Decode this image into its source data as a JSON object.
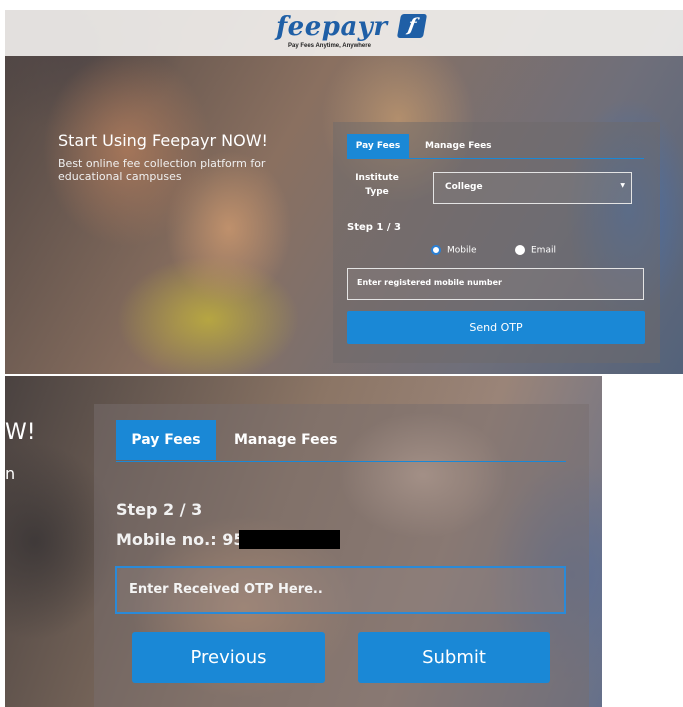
{
  "brand": {
    "logo_text": "feepayr",
    "logo_mark": "f",
    "tagline": "Pay Fees Anytime, Anywhere"
  },
  "hero": {
    "title": "Start Using Feepayr NOW!",
    "subtitle": "Best online fee collection platform for educational campuses"
  },
  "step1_form": {
    "tabs": [
      "Pay Fees",
      "Manage Fees"
    ],
    "active_tab": "Pay Fees",
    "institute_type_label": "Institute Type",
    "institute_type_value": "College",
    "step_label": "Step 1 / 3",
    "radio_options": [
      "Mobile",
      "Email"
    ],
    "selected_option": "Mobile",
    "mobile_placeholder": "Enter registered mobile number",
    "send_button": "Send OTP"
  },
  "step2_form": {
    "hero_fragment": "W!",
    "hero_fragment_2": "n",
    "tabs": [
      "Pay Fees",
      "Manage Fees"
    ],
    "active_tab": "Pay Fees",
    "step_label": "Step 2 / 3",
    "mobile_label": "Mobile no.: 95",
    "otp_placeholder": "Enter Received OTP Here..",
    "previous_button": "Previous",
    "submit_button": "Submit"
  },
  "colors": {
    "accent": "#1a88d6",
    "brand": "#1f5fa6"
  }
}
